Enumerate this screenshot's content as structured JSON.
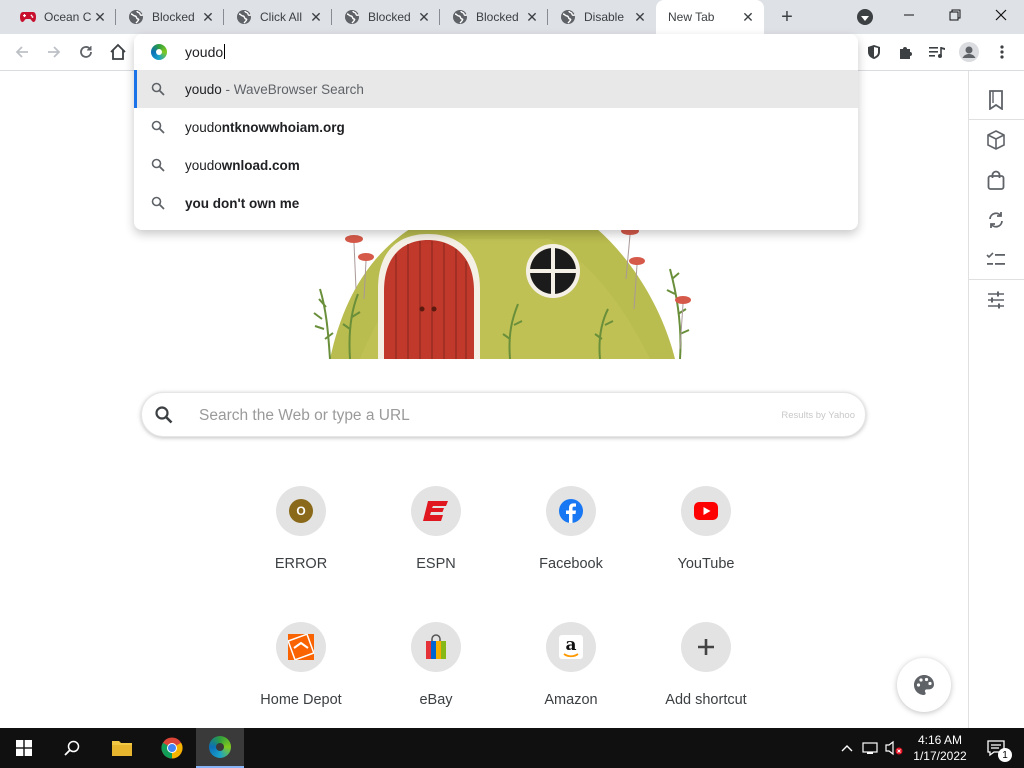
{
  "tabs": [
    {
      "title": "Ocean C",
      "icon": "gamepad-icon"
    },
    {
      "title": "Blocked",
      "icon": "globe-icon"
    },
    {
      "title": "Click All",
      "icon": "globe-icon"
    },
    {
      "title": "Blocked",
      "icon": "globe-icon"
    },
    {
      "title": "Blocked",
      "icon": "globe-icon"
    },
    {
      "title": "Disable",
      "icon": "globe-icon"
    },
    {
      "title": "New Tab",
      "icon": "none",
      "active": true
    }
  ],
  "omnibox": {
    "value": "youdo",
    "suggestions": [
      {
        "match": "youdo",
        "rest": "",
        "desc": " - WaveBrowser Search",
        "selected": true
      },
      {
        "match": "youdo",
        "rest": "ntknowwhoiam.org",
        "desc": ""
      },
      {
        "match": "youdo",
        "rest": "wnload.com",
        "desc": ""
      },
      {
        "match": "",
        "rest": "you don't own me",
        "desc": ""
      }
    ]
  },
  "search": {
    "placeholder": "Search the Web or type a URL",
    "results_by": "Results by Yahoo"
  },
  "shortcuts": [
    {
      "label": "ERROR"
    },
    {
      "label": "ESPN"
    },
    {
      "label": "Facebook"
    },
    {
      "label": "YouTube"
    },
    {
      "label": "Home Depot"
    },
    {
      "label": "eBay"
    },
    {
      "label": "Amazon"
    },
    {
      "label": "Add shortcut"
    }
  ],
  "taskbar": {
    "time": "4:16 AM",
    "date": "1/17/2022",
    "notification_count": "1"
  },
  "colors": {
    "accent": "#1a73e8",
    "tabstrip": "#dee1e6"
  }
}
